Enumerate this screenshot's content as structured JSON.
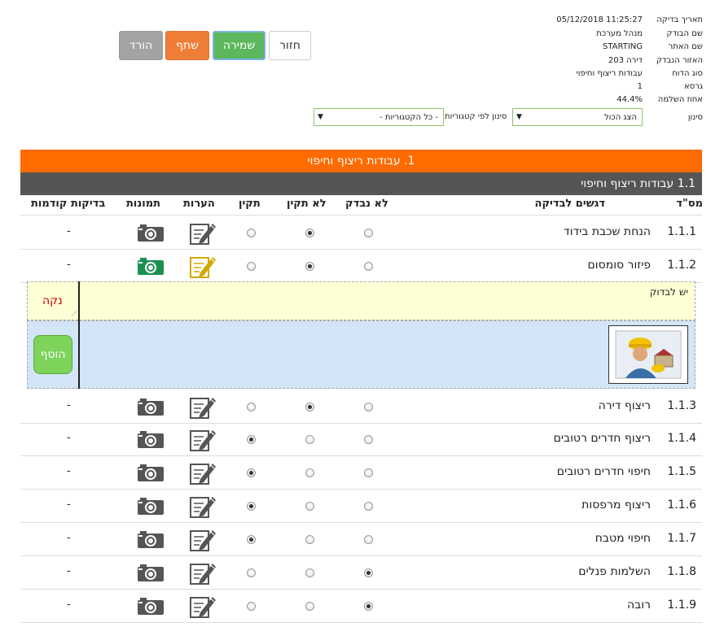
{
  "toolbar": {
    "download": "הורד",
    "share": "שתף",
    "save": "שמירה",
    "back": "חזור"
  },
  "info": {
    "rows": [
      {
        "label": "תאריך בדיקה",
        "value": "11:25:27 05/12/2018"
      },
      {
        "label": "שם הבודק",
        "value": "מנהל מערכת"
      },
      {
        "label": "שם האתר",
        "value": "STARTING"
      },
      {
        "label": "האזור הנבדק",
        "value": "דירה 203"
      },
      {
        "label": "סוג הדוח",
        "value": "עבודות ריצוף וחיפוי"
      },
      {
        "label": "גרסא",
        "value": "1"
      },
      {
        "label": "אחוז השלמה",
        "value": "44.4%"
      }
    ],
    "filter_label": "סינון",
    "filter_show": "הצג הכול",
    "filter_category_label": "סינון לפי קטגוריות",
    "filter_category": "- כל הקטגוריות -"
  },
  "section": {
    "title": "1. עבודות ריצוף וחיפוי",
    "sub_title": "1.1 עבודות ריצוף וחיפוי"
  },
  "columns": {
    "num": "מס\"ד",
    "focus": "דגשים לבדיקה",
    "not_checked": "לא נבדק",
    "not_ok": "לא תקין",
    "ok": "תקין",
    "notes": "הערות",
    "photos": "תמונות",
    "previous": "בדיקות קודמות"
  },
  "rows": [
    {
      "num": "1.1.1",
      "name": "הנחת שכבת בידוד",
      "status": "not_ok",
      "prev": "-"
    },
    {
      "num": "1.1.2",
      "name": "פיזור סומסום",
      "status": "not_ok",
      "prev": "-"
    },
    {
      "num": "1.1.3",
      "name": "ריצוף דירה",
      "status": "not_ok",
      "prev": "-"
    },
    {
      "num": "1.1.4",
      "name": "ריצוף חדרים רטובים",
      "status": "ok",
      "prev": "-"
    },
    {
      "num": "1.1.5",
      "name": "חיפוי חדרים רטובים",
      "status": "ok",
      "prev": "-"
    },
    {
      "num": "1.1.6",
      "name": "ריצוף מרפסות",
      "status": "ok",
      "prev": "-"
    },
    {
      "num": "1.1.7",
      "name": "חיפוי מטבח",
      "status": "ok",
      "prev": "-"
    },
    {
      "num": "1.1.8",
      "name": "השלמות פנלים",
      "status": "not_checked",
      "prev": "-"
    },
    {
      "num": "1.1.9",
      "name": "רובה",
      "status": "not_checked",
      "prev": "-"
    }
  ],
  "expanded": {
    "note_text": "יש לבדוק",
    "clear": "נקה",
    "add": "הוסף"
  },
  "colors": {
    "orange": "#ff6b00",
    "dark_gray": "#555555",
    "green": "#5cb85c"
  }
}
